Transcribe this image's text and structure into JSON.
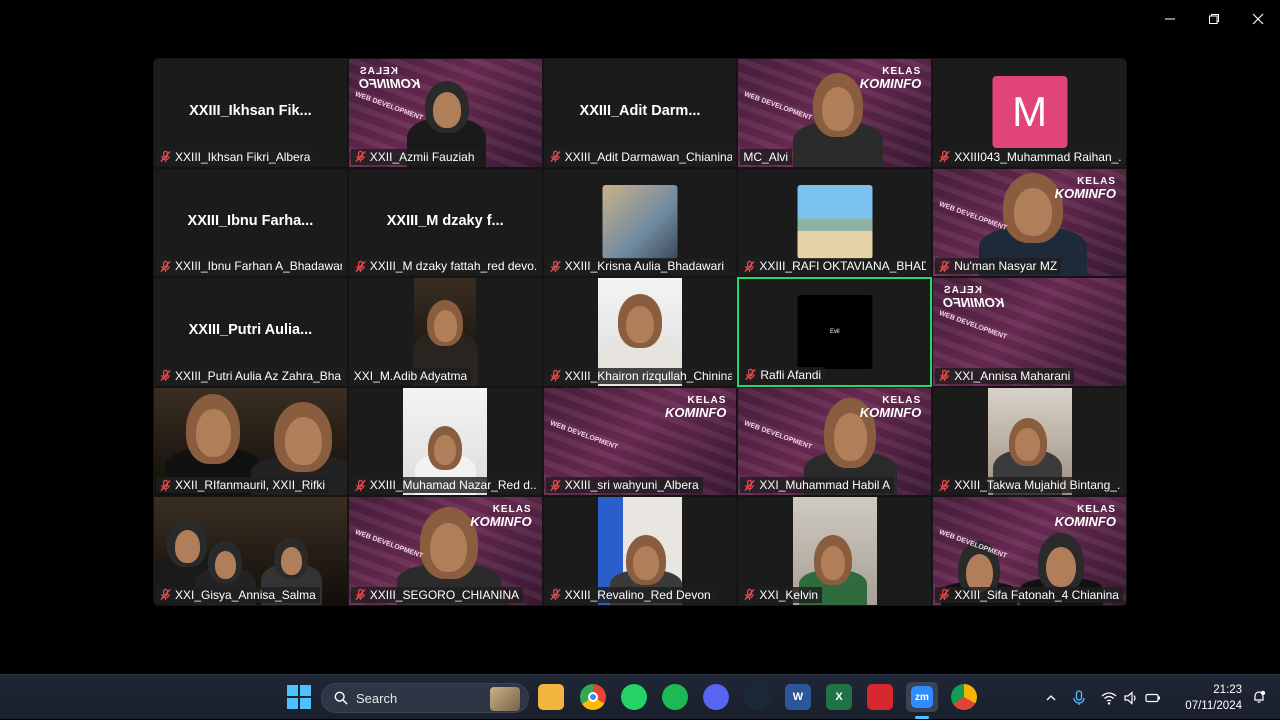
{
  "window": {
    "controls": [
      {
        "name": "minimize",
        "icon": "minimize-icon"
      },
      {
        "name": "restore",
        "icon": "restore-icon"
      },
      {
        "name": "close",
        "icon": "close-icon"
      }
    ]
  },
  "participants": [
    {
      "name": "XXIII_Ikhsan Fikri_Albera",
      "display": "XXIII_Ikhsan  Fik...",
      "muted": true,
      "video": false
    },
    {
      "name": "XXII_Azmii Fauziah",
      "muted": true,
      "video": true,
      "bg": "kominfo"
    },
    {
      "name": "XXIII_Adit Darmawan_Chianina",
      "display": "XXIII_Adit  Darm...",
      "muted": true,
      "video": false
    },
    {
      "name": "MC_Alvi",
      "muted": false,
      "video": true,
      "bg": "kominfo"
    },
    {
      "name": "XXIII043_Muhammad Raihan_...",
      "avatar": "M",
      "muted": true,
      "video": false
    },
    {
      "name": "XXIII_Ibnu Farhan A_Bhadawari",
      "display": "XXIII_Ibnu  Farha...",
      "muted": true,
      "video": false
    },
    {
      "name": "XXIII_M dzaky fattah_red devo...",
      "display": "XXIII_M  dzaky  f...",
      "muted": true,
      "video": false
    },
    {
      "name": "XXIII_Krisna Aulia_Bhadawari",
      "muted": true,
      "video": false,
      "thumb": "anime"
    },
    {
      "name": "XXIII_RAFI OKTAVIANA_BHADA...",
      "muted": true,
      "video": false,
      "thumb": "beach"
    },
    {
      "name": "Nu'man Nasyar MZ",
      "muted": true,
      "video": true,
      "bg": "kominfo"
    },
    {
      "name": "XXIII_Putri Aulia Az Zahra_Bha...",
      "display": "XXIII_Putri  Aulia...",
      "muted": true,
      "video": false
    },
    {
      "name": "XXI_M.Adib Adyatma",
      "muted": false,
      "video": true
    },
    {
      "name": "XXIII_Khairon rizqullah_Chinina",
      "muted": true,
      "video": true
    },
    {
      "name": "Rafli Afandi",
      "muted": true,
      "video": false,
      "thumb": "black",
      "active": true,
      "thumb_text": "Evil"
    },
    {
      "name": "XXI_Annisa Maharani",
      "muted": true,
      "video": true,
      "bg": "kominfo"
    },
    {
      "name": "XXII_RIfanmauril, XXII_Rifki",
      "muted": true,
      "video": true
    },
    {
      "name": "XXIII_Muhamad Nazar_Red d...",
      "muted": true,
      "video": true
    },
    {
      "name": "XXIII_sri wahyuni_Albera",
      "muted": true,
      "video": true,
      "bg": "kominfo"
    },
    {
      "name": "XXI_Muhammad Habil A",
      "muted": true,
      "video": true,
      "bg": "kominfo"
    },
    {
      "name": "XXIII_Takwa Mujahid Bintang_...",
      "muted": true,
      "video": true
    },
    {
      "name": "XXI_Gisya_Annisa_Salma",
      "muted": true,
      "video": true
    },
    {
      "name": "XXIII_SEGORO_CHIANINA",
      "muted": true,
      "video": true,
      "bg": "kominfo"
    },
    {
      "name": "XXIII_Revalino_Red Devon",
      "muted": true,
      "video": true
    },
    {
      "name": "XXI_Kelvin",
      "muted": true,
      "video": true
    },
    {
      "name": "XXIII_Sifa Fatonah_4 Chianina",
      "muted": true,
      "video": true,
      "bg": "kominfo"
    }
  ],
  "background": {
    "line1": "KELAS",
    "line2": "KOMINFO",
    "tag": "WEB DEVELOPMENT"
  },
  "taskbar": {
    "search_placeholder": "Search",
    "apps": [
      "file-explorer-icon",
      "chrome-icon",
      "whatsapp-icon",
      "spotify-icon",
      "discord-icon",
      "steam-icon",
      "word-icon",
      "excel-icon",
      "acrobat-icon",
      "zoom-icon",
      "chrome-canary-icon"
    ],
    "zoom_label": "zm",
    "time": "21:23",
    "date": "07/11/2024"
  },
  "colors": {
    "active_speaker": "#23d96c",
    "muted_red": "#e5484d",
    "avatar_pink": "#e0447a",
    "accent": "#4cc2ff"
  }
}
